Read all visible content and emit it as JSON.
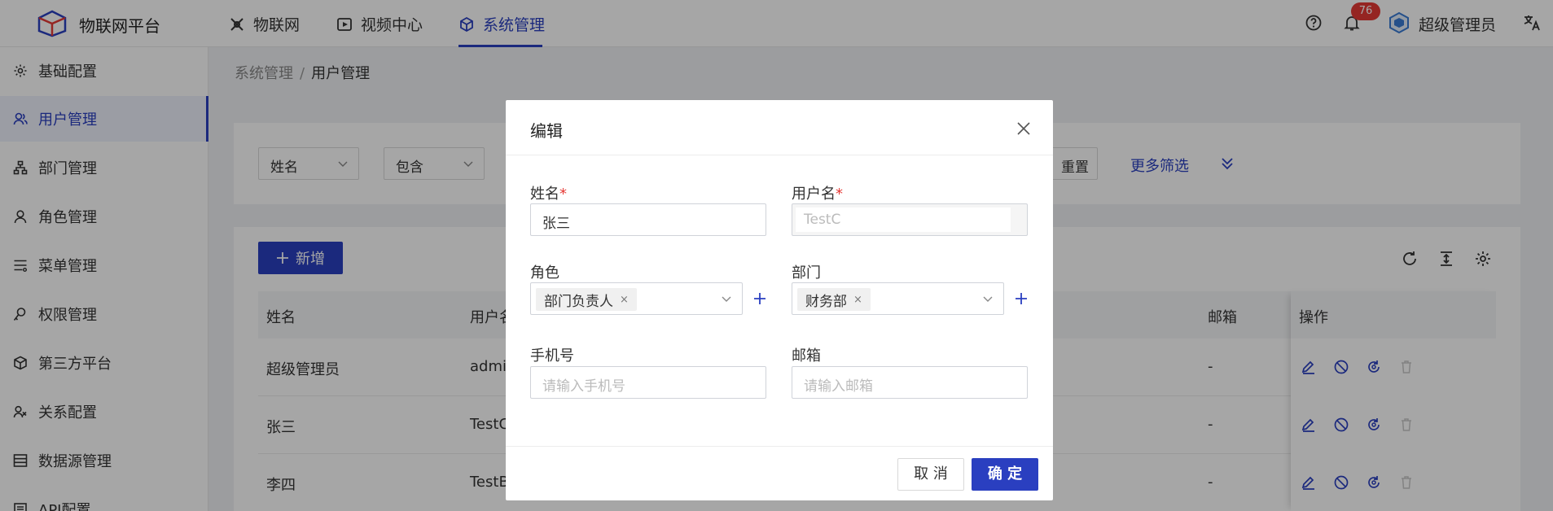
{
  "header": {
    "app_title": "物联网平台",
    "nav": [
      {
        "label": "物联网",
        "icon": "iot-icon"
      },
      {
        "label": "视频中心",
        "icon": "video-icon"
      },
      {
        "label": "系统管理",
        "icon": "cube-icon",
        "active": true
      }
    ],
    "notification_count": "76",
    "user_name": "超级管理员"
  },
  "sidebar": {
    "items": [
      {
        "label": "基础配置",
        "icon": "gear-icon"
      },
      {
        "label": "用户管理",
        "icon": "users-icon",
        "active": true
      },
      {
        "label": "部门管理",
        "icon": "org-icon"
      },
      {
        "label": "角色管理",
        "icon": "user-icon"
      },
      {
        "label": "菜单管理",
        "icon": "menu-icon"
      },
      {
        "label": "权限管理",
        "icon": "key-user-icon"
      },
      {
        "label": "第三方平台",
        "icon": "cube-icon"
      },
      {
        "label": "关系配置",
        "icon": "relation-icon"
      },
      {
        "label": "数据源管理",
        "icon": "database-icon"
      },
      {
        "label": "API配置",
        "icon": "api-icon"
      }
    ]
  },
  "breadcrumb": {
    "parent": "系统管理",
    "separator": "/",
    "current": "用户管理"
  },
  "filter": {
    "field_select": "姓名",
    "operator_select": "包含",
    "reset_label": "重置",
    "more_filter_label": "更多筛选"
  },
  "table": {
    "add_label": "新增",
    "columns": [
      "姓名",
      "用户名",
      "邮箱",
      "操作"
    ],
    "rows": [
      {
        "name": "超级管理员",
        "username": "admin",
        "email": "-"
      },
      {
        "name": "张三",
        "username": "TestC",
        "email": "-"
      },
      {
        "name": "李四",
        "username": "TestB",
        "email": "-"
      }
    ]
  },
  "modal": {
    "title": "编辑",
    "name_label": "姓名",
    "name_value": "张三",
    "username_label": "用户名",
    "username_value": "TestC",
    "required_mark": "*",
    "role_label": "角色",
    "role_tag": "部门负责人",
    "dept_label": "部门",
    "dept_tag": "财务部",
    "tag_close": "×",
    "phone_label": "手机号",
    "phone_placeholder": "请输入手机号",
    "email_label": "邮箱",
    "email_placeholder": "请输入邮箱",
    "cancel_label": "取 消",
    "ok_label": "确 定"
  },
  "colors": {
    "primary": "#2a3fc0",
    "danger": "#e53935"
  }
}
